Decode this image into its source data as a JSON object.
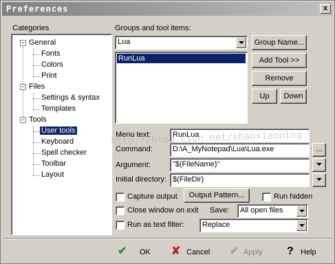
{
  "window": {
    "title": "Preferences",
    "close_glyph": "x"
  },
  "categories": {
    "label": "Categories",
    "tree": {
      "general": "General",
      "fonts": "Fonts",
      "colors": "Colors",
      "print": "Print",
      "files": "Files",
      "settings_syntax": "Settings & syntax",
      "templates": "Templates",
      "tools": "Tools",
      "user_tools": "User tools",
      "keyboard": "Keyboard",
      "spell_checker": "Spell checker",
      "toolbar": "Toolbar",
      "layout": "Layout",
      "expander_glyph": "−"
    }
  },
  "groups": {
    "label": "Groups and tool items:",
    "selected_group": "Lua",
    "items": [
      "RunLua"
    ],
    "buttons": {
      "group_name": "Group Name...",
      "add_tool": "Add Tool >>",
      "remove": "Remove",
      "up": "Up",
      "down": "Down"
    }
  },
  "form": {
    "menu_text_label": "Menu text:",
    "menu_text_value": "RunLua",
    "command_label": "Command:",
    "command_value": "D:\\A_MyNotepad\\Lua\\Lua.exe",
    "browse_label": "...",
    "argument_label": "Argument:",
    "argument_value": "\"$(FileName)\"",
    "initial_dir_label": "Initial directory:",
    "initial_dir_value": "$(FileDir)",
    "capture_output": "Capture output",
    "output_pattern": "Output Pattern...",
    "run_hidden": "Run hidden",
    "close_window": "Close window on exit",
    "save_label": "Save:",
    "save_value": "All open files",
    "run_filter": "Run as text filter:",
    "filter_value": "Replace"
  },
  "footer": {
    "ok": "OK",
    "cancel": "Cancel",
    "apply": "Apply",
    "help": "Help",
    "ok_icon_glyph": "✔",
    "cancel_icon_glyph": "✘",
    "apply_icon_glyph": "✔",
    "help_icon_glyph": "?"
  },
  "watermark": "http://blog.csdn.net/shaoxiaoning",
  "colors": {
    "selection": "#0a246a",
    "face": "#d4d0c8",
    "ok_green": "#2f8f2f",
    "cancel_red": "#c02020"
  }
}
